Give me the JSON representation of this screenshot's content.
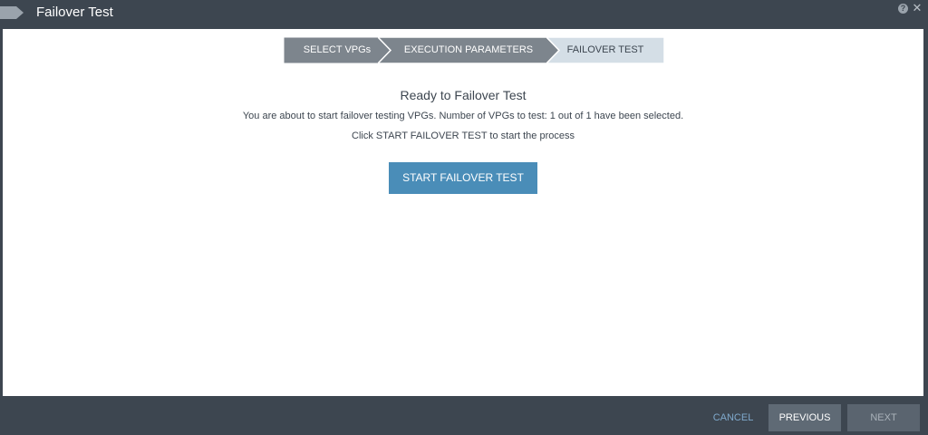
{
  "window": {
    "title": "Failover Test",
    "help_glyph": "?",
    "close_glyph": "✕"
  },
  "steps": [
    {
      "label": "SELECT VPGs",
      "state": "completed"
    },
    {
      "label": "EXECUTION PARAMETERS",
      "state": "completed"
    },
    {
      "label": "FAILOVER TEST",
      "state": "current"
    }
  ],
  "main": {
    "heading": "Ready to Failover Test",
    "description": "You are about to start failover testing VPGs. Number of VPGs to test: 1 out of 1 have been selected.",
    "hint": "Click START FAILOVER TEST to start the process",
    "start_button": "START FAILOVER TEST"
  },
  "footer": {
    "cancel": "CANCEL",
    "previous": "PREVIOUS",
    "next": "NEXT"
  },
  "colors": {
    "frame": "#3d4650",
    "step_completed": "#7d858d",
    "step_current": "#d4dee6",
    "primary_button": "#4a8db8",
    "cancel_link": "#7fa9cc"
  },
  "icons": {
    "title": "tag-icon",
    "help": "help-icon",
    "close": "close-icon"
  }
}
